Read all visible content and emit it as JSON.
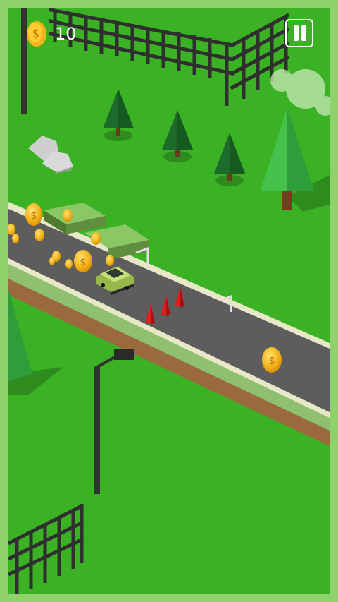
{
  "hud": {
    "coin_count": "10",
    "coin_icon": "coin-icon",
    "pause_icon": "pause-icon"
  },
  "colors": {
    "frame": "#8fd16a",
    "grass": "#3bb224",
    "road": "#5d5d5d",
    "road_edge": "#c8c8a0",
    "fence": "#3d3d3d",
    "coin": "#f4b51c",
    "cone": "#e11e1e",
    "car": "#b6d46a",
    "tree_dark": "#1f6f2a",
    "tree_light": "#46c84e"
  }
}
